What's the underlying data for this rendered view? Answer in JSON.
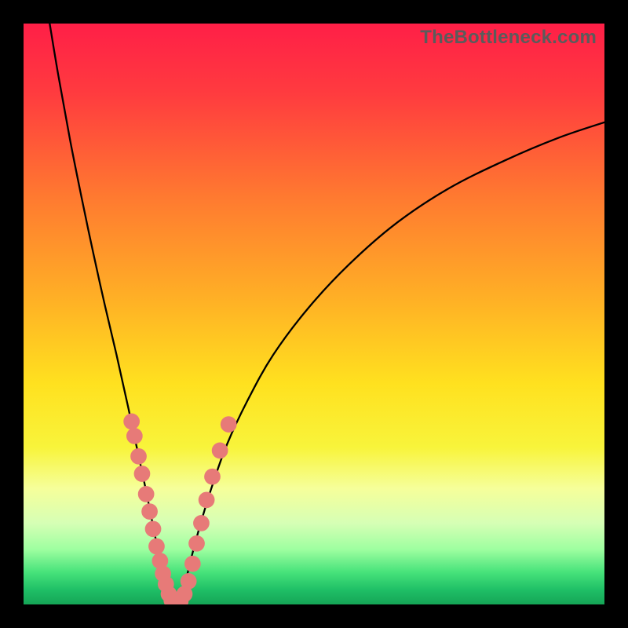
{
  "watermark": "TheBottleneck.com",
  "chart_data": {
    "type": "line",
    "title": "",
    "xlabel": "",
    "ylabel": "",
    "xlim": [
      0,
      100
    ],
    "ylim": [
      0,
      100
    ],
    "gradient_bands": [
      {
        "stop": 0.0,
        "color": "#ff1f47"
      },
      {
        "stop": 0.12,
        "color": "#ff3b3f"
      },
      {
        "stop": 0.3,
        "color": "#ff7a30"
      },
      {
        "stop": 0.48,
        "color": "#ffb225"
      },
      {
        "stop": 0.62,
        "color": "#ffe11f"
      },
      {
        "stop": 0.73,
        "color": "#f8f43b"
      },
      {
        "stop": 0.8,
        "color": "#f6ff9a"
      },
      {
        "stop": 0.86,
        "color": "#d6ffb5"
      },
      {
        "stop": 0.905,
        "color": "#9effa0"
      },
      {
        "stop": 0.945,
        "color": "#46e27a"
      },
      {
        "stop": 0.975,
        "color": "#1fbf66"
      },
      {
        "stop": 1.0,
        "color": "#15a556"
      }
    ],
    "series": [
      {
        "name": "left-branch",
        "color": "#000000",
        "stroke_width": 2.3,
        "x": [
          4.5,
          6,
          8,
          10,
          12,
          14,
          16,
          18,
          19.5,
          21,
          22.2,
          23.2,
          24,
          24.8,
          25.3
        ],
        "y": [
          100,
          91,
          80,
          70,
          60.5,
          51.5,
          43,
          34,
          27,
          20,
          14,
          9,
          5,
          2,
          0
        ]
      },
      {
        "name": "right-branch",
        "color": "#000000",
        "stroke_width": 2.3,
        "x": [
          27,
          27.8,
          29,
          30.5,
          32.5,
          35,
          38.5,
          43,
          49,
          56,
          64,
          73,
          83,
          92,
          100
        ],
        "y": [
          0,
          3.5,
          8.5,
          14,
          20.5,
          27.5,
          35,
          43,
          51,
          58.5,
          65.5,
          71.5,
          76.5,
          80.3,
          83
        ]
      }
    ],
    "dots": {
      "name": "data-points",
      "color": "#e77a78",
      "radius": 1.4,
      "points": [
        {
          "x": 18.6,
          "y": 31.5
        },
        {
          "x": 19.1,
          "y": 29.0
        },
        {
          "x": 19.8,
          "y": 25.5
        },
        {
          "x": 20.4,
          "y": 22.5
        },
        {
          "x": 21.1,
          "y": 19.0
        },
        {
          "x": 21.7,
          "y": 16.0
        },
        {
          "x": 22.3,
          "y": 13.0
        },
        {
          "x": 22.9,
          "y": 10.0
        },
        {
          "x": 23.5,
          "y": 7.5
        },
        {
          "x": 24.0,
          "y": 5.3
        },
        {
          "x": 24.5,
          "y": 3.5
        },
        {
          "x": 25.0,
          "y": 1.8
        },
        {
          "x": 25.5,
          "y": 0.7
        },
        {
          "x": 26.2,
          "y": 0.2
        },
        {
          "x": 27.0,
          "y": 0.5
        },
        {
          "x": 27.7,
          "y": 1.8
        },
        {
          "x": 28.4,
          "y": 4.0
        },
        {
          "x": 29.1,
          "y": 7.0
        },
        {
          "x": 29.8,
          "y": 10.5
        },
        {
          "x": 30.6,
          "y": 14.0
        },
        {
          "x": 31.5,
          "y": 18.0
        },
        {
          "x": 32.5,
          "y": 22.0
        },
        {
          "x": 33.8,
          "y": 26.5
        },
        {
          "x": 35.3,
          "y": 31.0
        }
      ]
    }
  }
}
